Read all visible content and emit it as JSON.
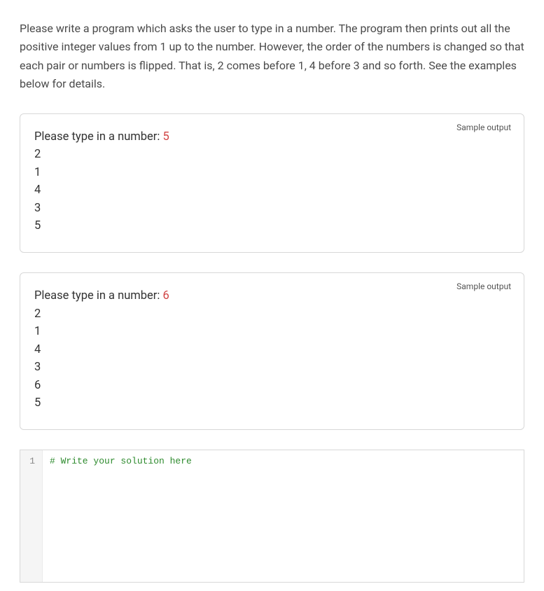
{
  "problem": {
    "description": "Please write a program which asks the user to type in a number. The program then prints out all the positive integer values from 1 up to the number. However, the order of the numbers is changed so that each pair or numbers is flipped. That is, 2 comes before 1, 4 before 3 and so forth. See the examples below for details."
  },
  "samples": [
    {
      "label": "Sample output",
      "prompt": "Please type in a number: ",
      "input": "5",
      "output_lines": [
        "2",
        "1",
        "4",
        "3",
        "5"
      ]
    },
    {
      "label": "Sample output",
      "prompt": "Please type in a number: ",
      "input": "6",
      "output_lines": [
        "2",
        "1",
        "4",
        "3",
        "6",
        "5"
      ]
    }
  ],
  "editor": {
    "line_number": "1",
    "code_comment": "# Write your solution here"
  }
}
